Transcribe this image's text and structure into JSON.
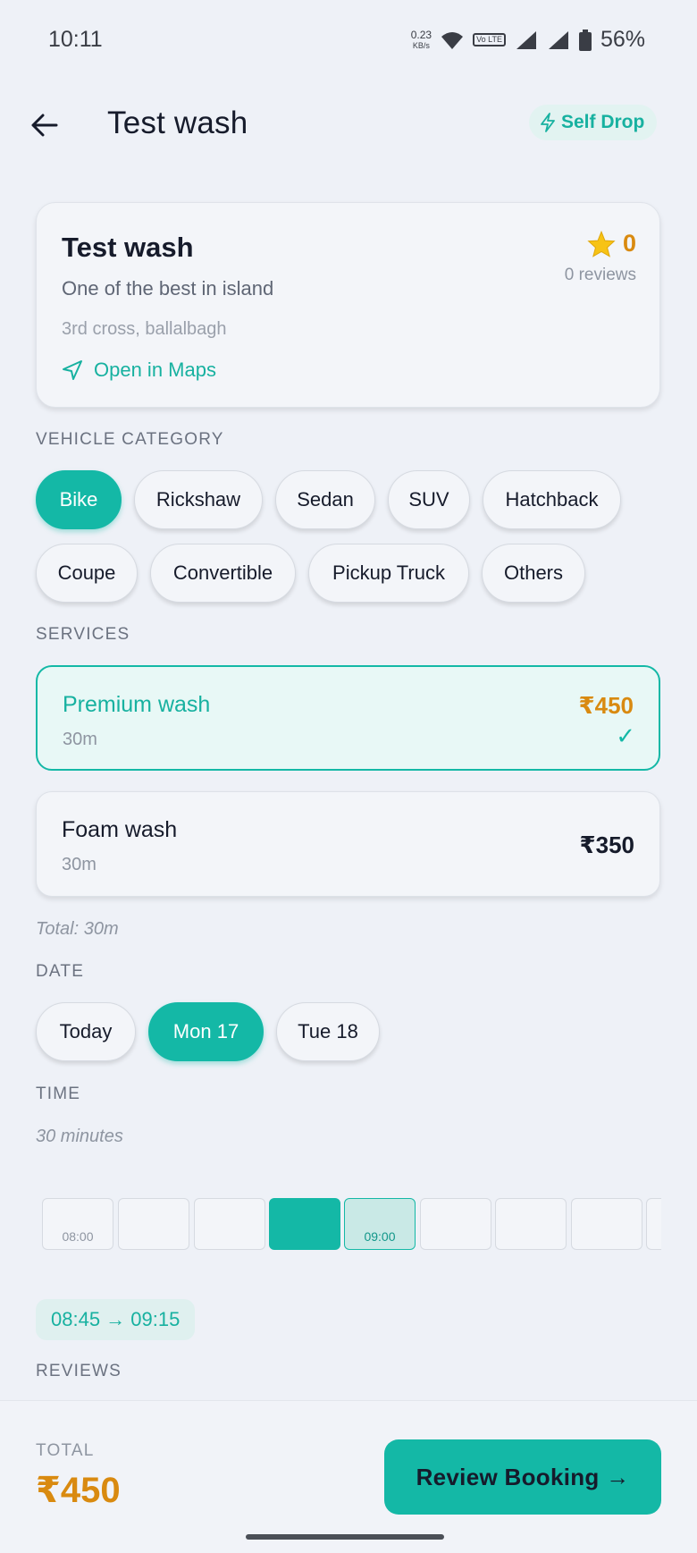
{
  "status_bar": {
    "time": "10:11",
    "net_speed": "0.23",
    "net_unit": "KB/s",
    "volte": "Vo LTE",
    "battery": "56%"
  },
  "header": {
    "title": "Test wash",
    "badge": "Self Drop"
  },
  "shop": {
    "name": "Test wash",
    "description": "One of the best in island",
    "address": "3rd cross, ballalbagh",
    "maps_label": "Open in Maps",
    "rating": "0",
    "reviews_label": "0 reviews"
  },
  "vehicle": {
    "label": "VEHICLE CATEGORY",
    "options": [
      "Bike",
      "Rickshaw",
      "Sedan",
      "SUV",
      "Hatchback",
      "Coupe",
      "Convertible",
      "Pickup Truck",
      "Others"
    ],
    "selected": "Bike"
  },
  "services": {
    "label": "SERVICES",
    "items": [
      {
        "name": "Premium wash",
        "duration": "30m",
        "price": "₹450",
        "selected": true
      },
      {
        "name": "Foam wash",
        "duration": "30m",
        "price": "₹350",
        "selected": false
      }
    ],
    "total_note": "Total: 30m"
  },
  "date": {
    "label": "DATE",
    "options": [
      "Today",
      "Mon 17",
      "Tue 18"
    ],
    "selected": "Mon 17"
  },
  "time": {
    "label": "TIME",
    "duration_note": "30 minutes",
    "slot_labels": [
      "08:00",
      "09:00"
    ],
    "range": "08:45 → 09:15"
  },
  "reviews": {
    "label": "REVIEWS"
  },
  "footer": {
    "total_label": "TOTAL",
    "total_value": "₹450",
    "cta": "Review Booking →"
  },
  "colors": {
    "accent": "#14b8a6",
    "price": "#d98a10",
    "background": "#eef1f7"
  }
}
